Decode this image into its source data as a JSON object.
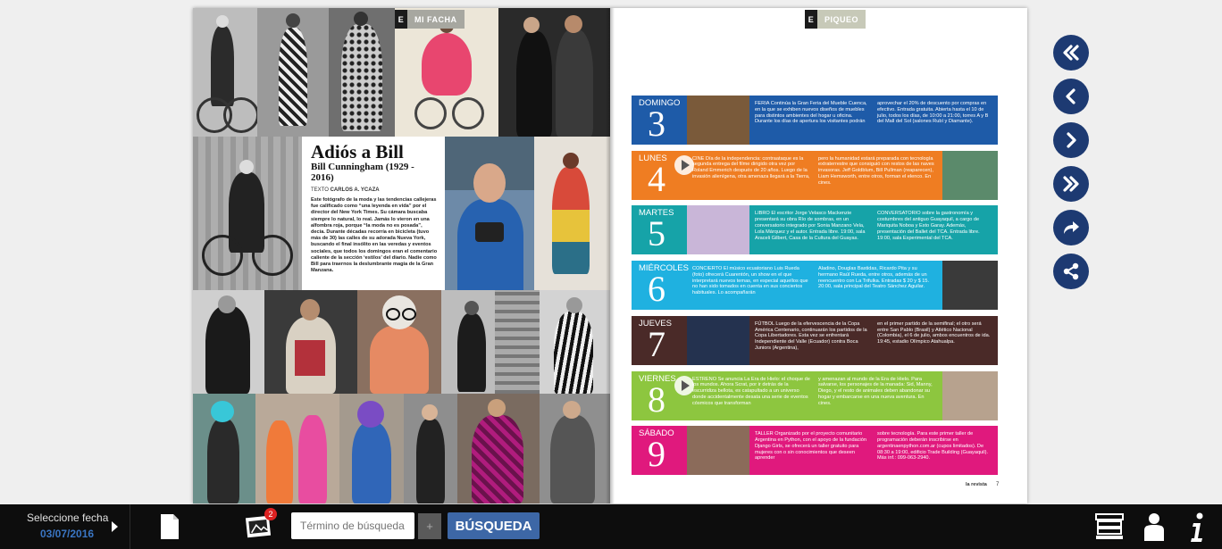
{
  "left_page": {
    "section_e": "E",
    "section_label": "MI FACHA",
    "article": {
      "title": "Adiós a Bill",
      "subtitle": "Bill Cunningham (1929 - 2016)",
      "byline_prefix": "TEXTO",
      "byline_author": "CARLOS A. YCAZA",
      "body": "Este fotógrafo de la moda y las tendencias callejeras fue calificado como “una leyenda en vida” por el director del New York Times. Su cámara buscaba siempre lo natural, lo real. Jamás lo vieron en una alfombra roja, porque “la moda no es posada”, decía. Durante décadas recorría en bicicleta (tuvo más de 30) las calles de su adorada Nueva York, buscando el final insólito en las veredas y eventos sociales, que todos los domingos eran el comentario caliente de la sección ‘estilos’ del diario. Nadie como Bill para traernos la deslumbrante magia de la Gran Manzana."
    }
  },
  "right_page": {
    "section_e": "E",
    "section_label": "PIQUEO",
    "footer_brand": "la revista",
    "page_number": "7",
    "days": [
      {
        "name": "DOMINGO",
        "number": "3",
        "color": "#1e5ba8",
        "col1": "FERIA Continúa la Gran Feria del Mueble Cuenca, en la que se exhiben nuevos diseños de muebles para distintos ambientes del hogar u oficina. Durante los días de apertura los visitantes podrán",
        "col2": "aprovechar el 20% de descuento por compras en efectivo. Entrada gratuita. Abierta hasta el 10 de julio, todos los días, de 10:00 a 21:00, torres A y B del Mall del Sol (salones Rubí y Diamante)."
      },
      {
        "name": "LUNES",
        "number": "4",
        "color": "#ef7d22",
        "col1": "CINE Día de la independencia: contraataque es la segunda entrega del filme dirigido otra vez por Roland Emmerich después de 20 años. Luego de la invasión alienígena, otra amenaza llegará a la Tierra,",
        "col2": "pero la humanidad estará preparada con tecnología extraterrestre que consiguió con restos de las naves invasoras. Jeff Goldblum, Bill Pullman (reaparecen), Liam Hemsworth, entre otros, forman el elenco. En cines."
      },
      {
        "name": "MARTES",
        "number": "5",
        "color": "#16a3a8",
        "col1": "LIBRO El escritor Jorge Velasco Mackenzie presentará su obra Río de sombras, en un conversatorio integrado por Sonia Manzano Vela, Lola Márquez y el autor. Entrada libre. 19:00, sala Araceli Gilbert, Casa de la Cultura del Guayas.",
        "col2": "CONVERSATORIO sobre la gastronomía y costumbres del antiguo Guayaquil, a cargo de Mariquita Noboa y Esto Garay. Además, presentación del Ballet del TCA. Entrada libre. 19:00, sala Experimental del TCA."
      },
      {
        "name": "MIÉRCOLES",
        "number": "6",
        "color": "#1fb1e0",
        "col1": "CONCIERTO El músico ecuatoriano Luis Rueda (foto) ofrecerá Cuarentón, un show en el que interpretará nuevos temas, en especial aquellos que no han sido tomados en cuenta en sus conciertos habituales. Lo acompañarán",
        "col2": "Aladino, Douglas Bastidas, Ricardo Pita y su hermano Raúl Rueda, entre otros, además de un reencuentro con La Trifulka. Entradas $ 20 y $ 15. 20:00, sala principal del Teatro Sánchez Aguilar."
      },
      {
        "name": "JUEVES",
        "number": "7",
        "color": "#4a2a28",
        "col1": "FÚTBOL Luego de la efervescencia de la Copa América Centenario, continuarán los partidos de la Copa Libertadores. Esta vez se enfrentará Independiente del Valle (Ecuador) contra Boca Juniors (Argentina),",
        "col2": "en el primer partido de la semifinal; el otro será entre San Pablo (Brasil) y Atlético Nacional (Colombia), el 6 de julio, ambos encuentros de ida. 19:45, estadio Olímpico Atahualpa."
      },
      {
        "name": "VIERNES",
        "number": "8",
        "color": "#8dc63f",
        "col1": "ESTRENO Se anuncia La Era de Hielo: el choque de los mundos. Ahora Scrat, por ir detrás de la escurridiza bellota, es catapultado a un universo donde accidentalmente desata una serie de eventos cósmicos que transforman",
        "col2": "y amenazan al mundo de la Era de Hielo. Para salvarse, los personajes de la manada: Sid, Manny, Diego, y el resto de animales deben abandonar su hogar y embarcarse en una nueva aventura. En cines."
      },
      {
        "name": "SÁBADO",
        "number": "9",
        "color": "#e0197d",
        "col1": "TALLER Organizado por el proyecto comunitario Argentina en Python, con el apoyo de la fundación Django Girls, se ofrecerá un taller gratuito para mujeres con o sin conocimientos que deseen aprender",
        "col2": "sobre tecnología. Para este primer taller de programación deberán inscribirse en argentinaenpython.com.ar (cupos limitados). De 08:30 a 19:00, edificio Trade Building (Guayaquil). Más inf.: 099-063-2940."
      }
    ]
  },
  "nav": {
    "first_icon": "double-chevron-left-icon",
    "prev_icon": "chevron-left-icon",
    "next_icon": "chevron-right-icon",
    "last_icon": "double-chevron-right-icon",
    "forward_icon": "forward-share-icon",
    "share_icon": "share-nodes-icon",
    "button_color": "#1d3a72"
  },
  "bottom_bar": {
    "date_label": "Seleccione fecha",
    "date_value": "03/07/2016",
    "gallery_badge": "2",
    "search_placeholder": "Término de búsqueda",
    "plus_label": "+",
    "search_button": "BÚSQUEDA",
    "accent": "#3d67a6"
  }
}
